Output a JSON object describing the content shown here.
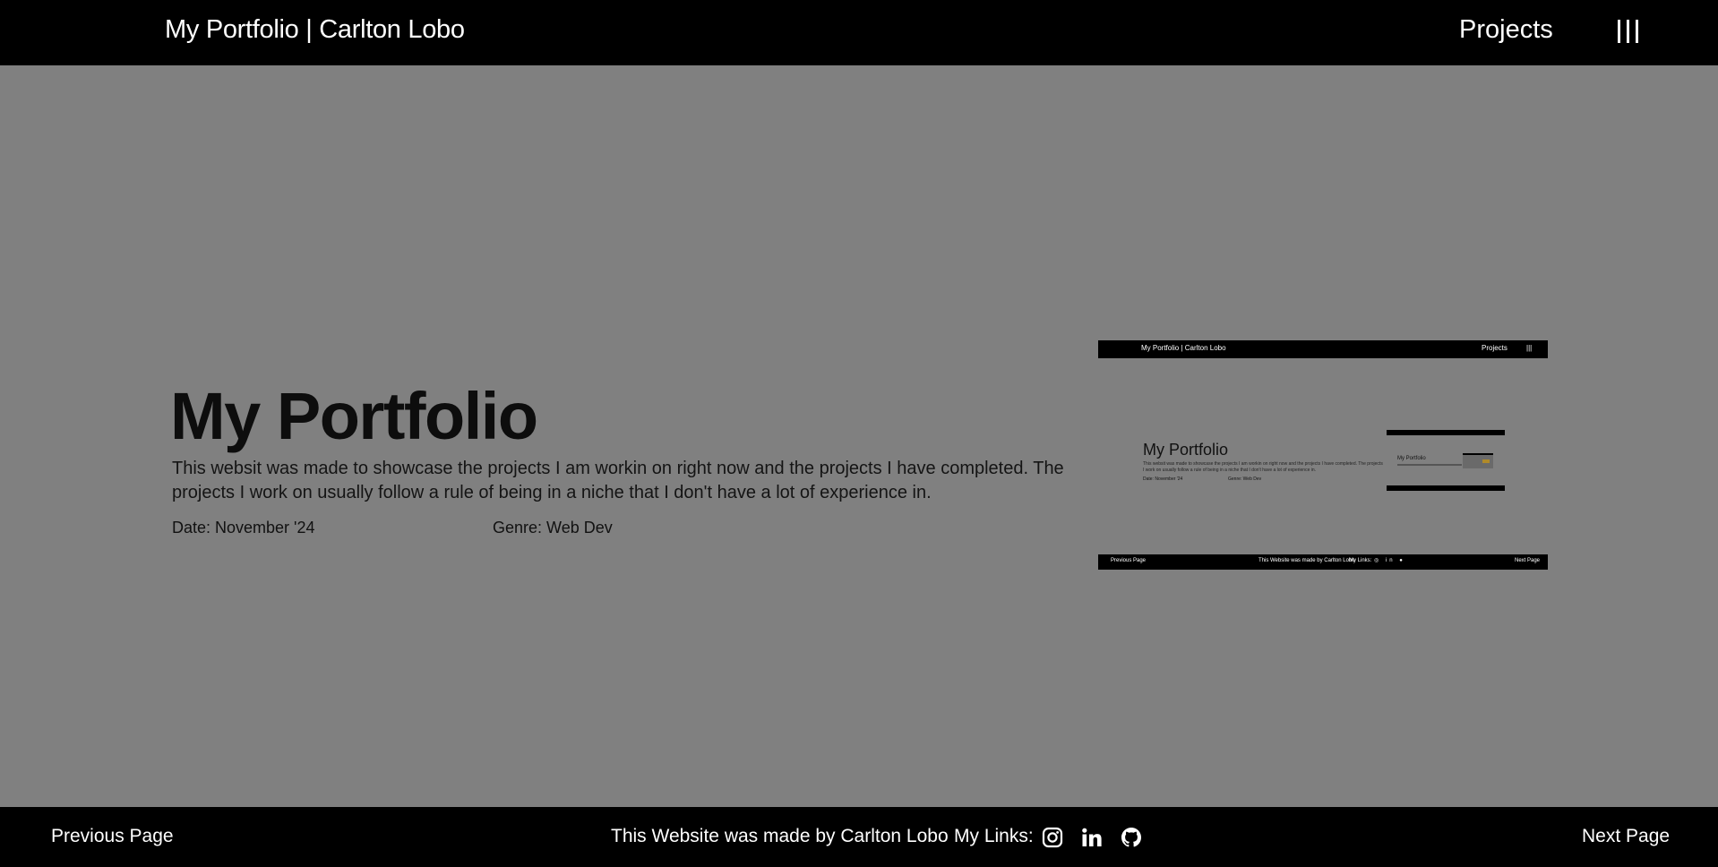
{
  "header": {
    "site_title": "My Portfolio | Carlton Lobo",
    "nav_projects": "Projects",
    "menu_icon": "hamburger-bars-icon"
  },
  "main": {
    "title": "My Portfolio",
    "description": "This websit was made to showcase the projects I am workin on right now and the projects I have completed. The projects I work on usually follow a rule of being in a niche that I don't have a lot of experience in.",
    "date": "Date: November '24",
    "genre": "Genre: Web Dev"
  },
  "preview": {
    "header_title": "My Portfolio | Carlton Lobo",
    "header_projects": "Projects",
    "header_menu": "|||",
    "title": "My Portfolio",
    "description": "This websit was made to showcase the projects I am workin on right now and the projects I have completed. The projects I work on usually follow a rule of being in a niche that I don't have a lot of experience in.",
    "date": "Date: November '24",
    "genre": "Genre: Web Dev",
    "nested_title": "My Portfolio",
    "footer_prev": "Previous Page",
    "footer_made_by": "This Website was made by Carlton Lobo",
    "footer_links": "My Links:",
    "footer_icons": "◎ in ●",
    "footer_next": "Next Page"
  },
  "footer": {
    "previous_page": "Previous Page",
    "made_by": "This Website was made by Carlton Lobo",
    "my_links": "My Links:",
    "icons": [
      "instagram-icon",
      "linkedin-icon",
      "github-icon"
    ],
    "next_page": "Next Page"
  },
  "colors": {
    "background": "#808080",
    "bar": "#000000",
    "text_light": "#ffffff",
    "text_dark": "#111111"
  }
}
